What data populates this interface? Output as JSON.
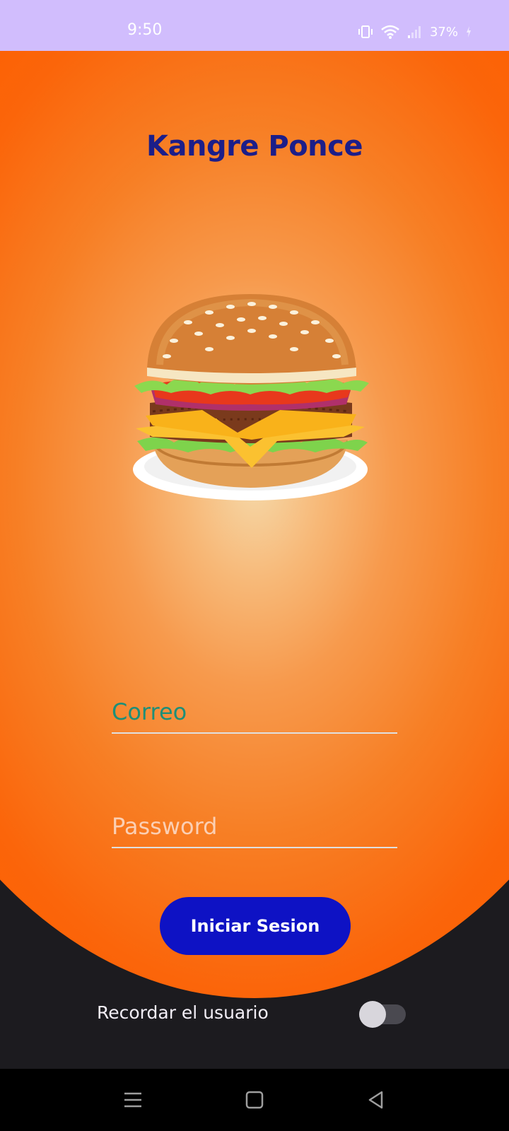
{
  "status_bar": {
    "time": "9:50",
    "battery": "37%",
    "icons": [
      "vibrate-icon",
      "wifi-icon",
      "signal-icon",
      "battery-charging-icon"
    ]
  },
  "app": {
    "title": "Kangre Ponce",
    "image": "hamburger-illustration"
  },
  "form": {
    "email_placeholder": "Correo",
    "password_placeholder": "Password",
    "login_label": "Iniciar Sesion",
    "remember_label": "Recordar el usuario",
    "remember_enabled": false
  },
  "nav_bar": {
    "buttons": [
      "recents-icon",
      "home-icon",
      "back-icon"
    ]
  },
  "colors": {
    "status_bar": "#d1bdfd",
    "orange": "#fd5f00",
    "title": "#1c1e89",
    "button": "#0e12c4",
    "email_text": "#1e8f78",
    "dark_bg": "#1c1b1f"
  }
}
